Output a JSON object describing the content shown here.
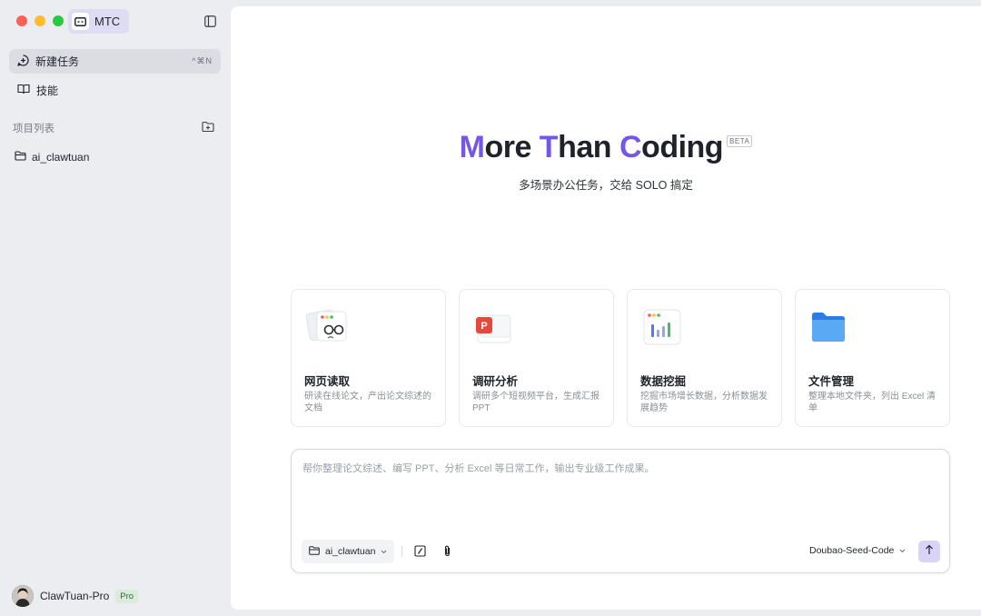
{
  "window": {
    "app_name": "MTC"
  },
  "sidebar": {
    "nav": [
      {
        "label": "新建任务",
        "shortcut": "^⌘N",
        "icon": "new-task-icon"
      },
      {
        "label": "技能",
        "icon": "book-icon"
      }
    ],
    "projects_label": "项目列表",
    "projects": [
      {
        "name": "ai_clawtuan",
        "icon": "folder-icon"
      }
    ],
    "user": {
      "name": "ClawTuan-Pro",
      "badge": "Pro"
    }
  },
  "hero": {
    "title_parts": [
      "M",
      "ore ",
      "T",
      "han ",
      "C",
      "oding"
    ],
    "beta": "BETA",
    "subtitle": "多场景办公任务，交给 SOLO 搞定"
  },
  "cards": [
    {
      "title": "网页读取",
      "desc": "研读在线论文，产出论文综述的文档",
      "icon": "web-reader-icon"
    },
    {
      "title": "调研分析",
      "desc": "调研多个短视频平台，生成汇报 PPT",
      "icon": "ppt-icon"
    },
    {
      "title": "数据挖掘",
      "desc": "挖掘市场增长数据，分析数据发展趋势",
      "icon": "chart-icon"
    },
    {
      "title": "文件管理",
      "desc": "整理本地文件夹，列出 Excel 清单",
      "icon": "folder-icon"
    }
  ],
  "composer": {
    "placeholder": "帮你整理论文综述、编写 PPT、分析 Excel 等日常工作，输出专业级工作成果。",
    "project": "ai_clawtuan",
    "model": "Doubao-Seed-Code"
  },
  "colors": {
    "accent": "#7457e8",
    "sidebar_bg": "#ecedf1",
    "send_bg": "#d9d4f7"
  }
}
